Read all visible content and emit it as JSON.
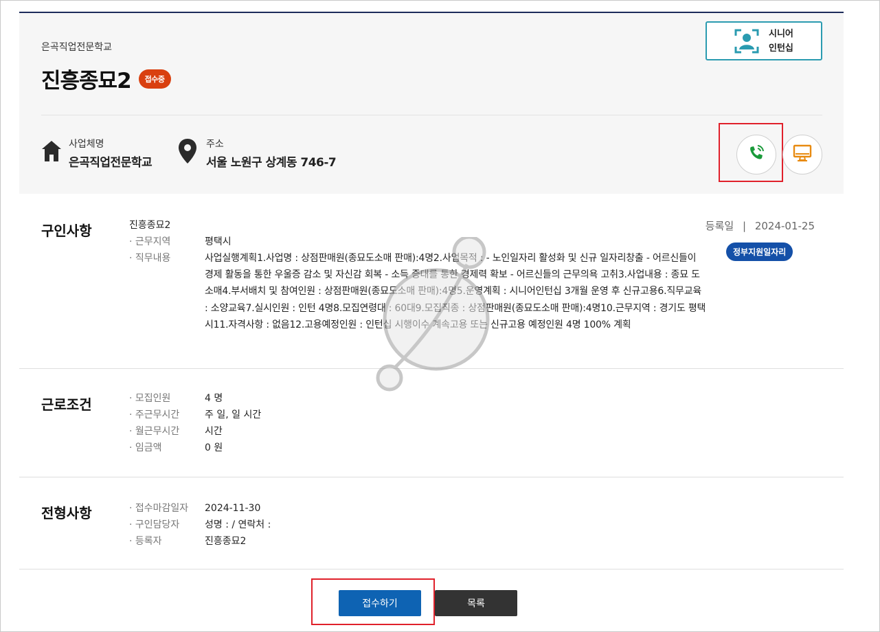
{
  "header": {
    "org_name": "은곡직업전문학교",
    "title": "진흥종묘2",
    "status_badge": "접수중",
    "senior_box": {
      "line1": "시니어",
      "line2": "인턴십"
    },
    "business": {
      "label": "사업체명",
      "value": "은곡직업전문학교"
    },
    "address": {
      "label": "주소",
      "value": "서울 노원구 상계동 746-7"
    }
  },
  "recruit": {
    "title": "구인사항",
    "job_name": "진흥종묘2",
    "reg_label": "등록일",
    "reg_sep": "|",
    "reg_date": "2024-01-25",
    "gov_badge": "정부지원일자리",
    "rows": [
      {
        "k": "· 근무지역",
        "v": "평택시"
      },
      {
        "k": "· 직무내용",
        "v": "사업실행계획1.사업명 : 상점판매원(종묘도소매 판매):4명2.사업목적 : - 노인일자리 활성화 및 신규 일자리창출 - 어르신들이 경제 활동을 통한 우울증 감소 및 자신감 회복 - 소득 증대를 통한 경제력 확보 - 어르신들의 근무의욕 고취3.사업내용 : 종묘 도소매4.부서배치 및 참여인원 : 상점판매원(종묘도소매 판매):4명5.운영계획 : 시니어인턴십 3개월 운영 후 신규고용6.직무교육 : 소양교육7.실시인원 : 인턴 4명8.모집연령대 : 60대9.모집직종 : 상점판매원(종묘도소매 판매):4명10.근무지역 : 경기도 평택시11.자격사항 : 없음12.고용예정인원 : 인턴십 시행이수 계속고용 또는 신규고용 예정인원 4명 100% 계획"
      }
    ]
  },
  "conditions": {
    "title": "근로조건",
    "rows": [
      {
        "k": "· 모집인원",
        "v": "4 명"
      },
      {
        "k": "· 주근무시간",
        "v": "주 일, 일 시간"
      },
      {
        "k": "· 월근무시간",
        "v": "시간"
      },
      {
        "k": "· 임금액",
        "v": "0 원"
      }
    ]
  },
  "selection": {
    "title": "전형사항",
    "rows": [
      {
        "k": "· 접수마감일자",
        "v": "2024-11-30"
      },
      {
        "k": "· 구인담당자",
        "v": "성명 : / 연락처 :"
      },
      {
        "k": "· 등록자",
        "v": "진흥종묘2"
      }
    ]
  },
  "buttons": {
    "apply": "접수하기",
    "list": "목록"
  },
  "colors": {
    "brand_navy": "#1c2b5a",
    "status_red": "#d94010",
    "apply_blue": "#0e63b3",
    "gov_blue": "#1450a8",
    "phone_green": "#1a9a3a",
    "monitor_orange": "#e88a10",
    "highlight_red": "#e0202a"
  },
  "icons": [
    "home-icon",
    "location-pin-icon",
    "phone-icon",
    "monitor-icon",
    "senior-intern-icon"
  ]
}
